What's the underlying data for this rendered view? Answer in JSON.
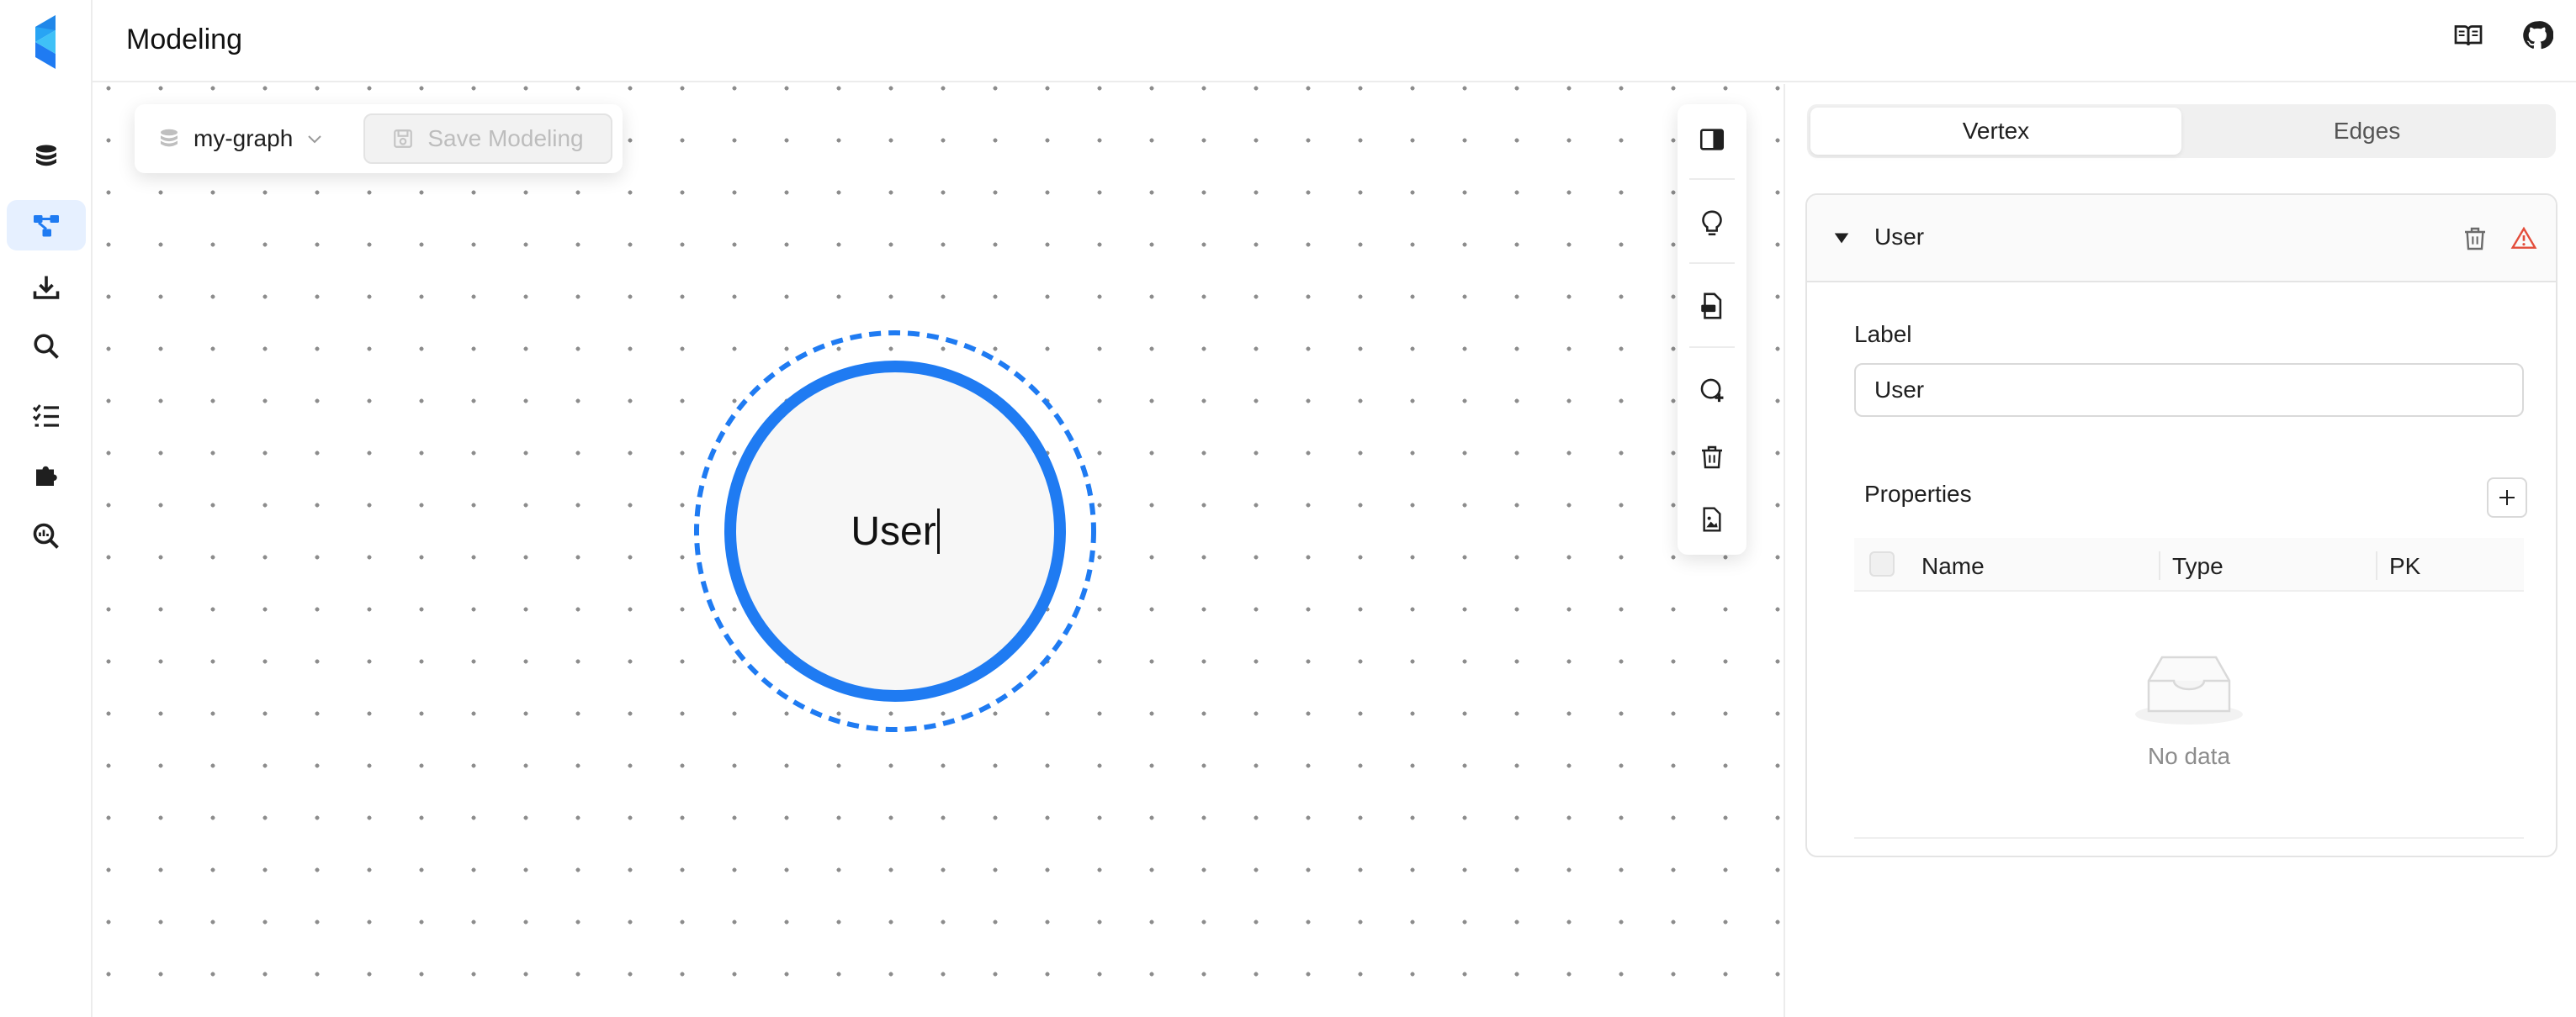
{
  "header": {
    "title": "Modeling",
    "doc_icon": "book-open-icon",
    "github_icon": "github-icon"
  },
  "sidebar": {
    "logo": "app-logo",
    "items": [
      {
        "icon": "database-icon",
        "active": false
      },
      {
        "icon": "graph-model-icon",
        "active": true
      },
      {
        "icon": "download-icon",
        "active": false
      },
      {
        "icon": "search-icon",
        "active": false
      },
      {
        "icon": "task-list-icon",
        "active": false
      },
      {
        "icon": "puzzle-icon",
        "active": false
      },
      {
        "icon": "chart-search-icon",
        "active": false
      }
    ]
  },
  "canvas": {
    "graph_selector": {
      "value": "my-graph",
      "icon": "database-icon"
    },
    "save_button": {
      "label": "Save Modeling",
      "icon": "save-icon",
      "disabled": true
    },
    "vertex_node": {
      "label": "User",
      "accent": "#1f7bf2"
    },
    "tools": [
      {
        "icon": "panel-right-icon"
      },
      {
        "icon": "lightbulb-icon"
      },
      {
        "icon": "file-export-icon"
      },
      {
        "icon": "add-node-icon"
      },
      {
        "icon": "trash-icon"
      },
      {
        "icon": "file-image-icon"
      }
    ]
  },
  "panel": {
    "tabs": [
      {
        "label": "Vertex",
        "active": true
      },
      {
        "label": "Edges",
        "active": false
      }
    ],
    "vertex": {
      "title": "User",
      "label_field": {
        "label": "Label",
        "value": "User"
      },
      "properties": {
        "title": "Properties",
        "columns": [
          "Name",
          "Type",
          "PK"
        ],
        "rows": [],
        "empty_text": "No data"
      }
    }
  },
  "colors": {
    "primary": "#1f7bf2",
    "warning": "#e34d3b",
    "active_bg": "#e6f0ff"
  }
}
